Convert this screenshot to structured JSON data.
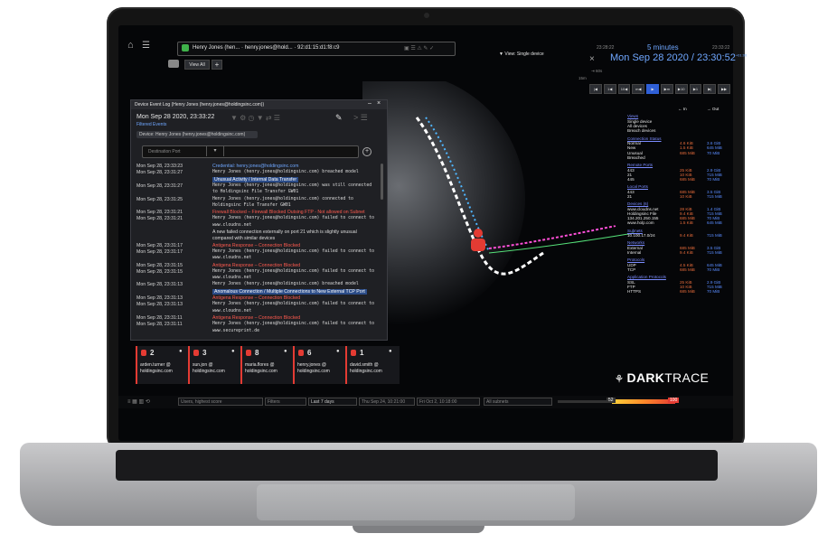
{
  "topbar": {
    "device_label": "Henry Jones (hen... · henry.jones@hold... · 92:d1:15:d1:f8:c9",
    "view_all": "View All",
    "view_mode": "View: Single device"
  },
  "timeline": {
    "time_left": "23:28:22",
    "window": "5 minutes",
    "time_right": "23:33:22",
    "clock": "Mon Sep 28 2020 / 23:30:52",
    "clock_sup": "+01:00",
    "scale_60": "60s",
    "scale_15m": "15m",
    "buttons": [
      "|◀",
      "1◀",
      "10◀",
      "m◀",
      "▶",
      "▶m",
      "▶10",
      "▶1",
      "▶|",
      "▶▶"
    ]
  },
  "event_log": {
    "title": "Device Event Log (Henry Jones (henry.jones@holdingsinc.com))",
    "date": "Mon Sep 28 2020, 23:33:22",
    "filtered": "Filtered Events",
    "device_chip": "Device: Henry Jones (henry.jones@holdingsinc.com)",
    "filter_placeholder": "Destination Port",
    "rows": [
      {
        "date": "Mon Sep 28, 23:33:23",
        "msg": "Credential: henry.jones@holdingsinc.com",
        "style": "blue"
      },
      {
        "date": "Mon Sep 28, 23:31:27",
        "msg": "Henry Jones (henry.jones@holdingsinc.com) breached model",
        "style": "mono"
      },
      {
        "date": "",
        "msg": "Unusual Activity / Internal Data Transfer",
        "style": "hl"
      },
      {
        "date": "Mon Sep 28, 23:31:27",
        "msg": "Henry Jones (henry.jones@holdingsinc.com) was still connected",
        "style": "mono"
      },
      {
        "date": "",
        "msg": "to Holdingsinc File Transfer GW01",
        "style": "mono"
      },
      {
        "date": "Mon Sep 28, 23:31:25",
        "msg": "Henry Jones (henry.jones@holdingsinc.com) connected to",
        "style": "mono"
      },
      {
        "date": "",
        "msg": "Holdingsinc File Transfer GW01",
        "style": "mono"
      },
      {
        "date": "Mon Sep 28, 23:31:21",
        "msg": "Firewall Blocked – Firewall Blocked Outsing FTP - Not allowed on Subnet",
        "style": "red"
      },
      {
        "date": "Mon Sep 28, 23:31:21",
        "msg": "Henry Jones (henry.jones@holdingsinc.com) failed to connect to",
        "style": "mono"
      },
      {
        "date": "",
        "msg": "www.cloudns.net",
        "style": "mono"
      },
      {
        "date": "",
        "msg": "A new failed connection externally on port 21 which is slightly unusual",
        "style": "plain"
      },
      {
        "date": "",
        "msg": "compared with similar devices",
        "style": "plain"
      },
      {
        "date": "Mon Sep 28, 23:31:17",
        "msg": "Antigena Response – Connection Blocked",
        "style": "red"
      },
      {
        "date": "Mon Sep 28, 23:31:17",
        "msg": "Henry Jones (henry.jones@holdingsinc.com) failed to connect to",
        "style": "mono"
      },
      {
        "date": "",
        "msg": "www.cloudns.net",
        "style": "mono"
      },
      {
        "date": "Mon Sep 28, 23:31:15",
        "msg": "Antigena Response – Connection Blocked",
        "style": "red"
      },
      {
        "date": "Mon Sep 28, 23:31:15",
        "msg": "Henry Jones (henry.jones@holdingsinc.com) failed to connect to",
        "style": "mono"
      },
      {
        "date": "",
        "msg": "www.cloudns.net",
        "style": "mono"
      },
      {
        "date": "Mon Sep 28, 23:31:13",
        "msg": "Henry Jones (henry.jones@holdingsinc.com) breached model",
        "style": "mono"
      },
      {
        "date": "",
        "msg": "Anomalous Connection / Multiple Connections to New External TCP Port",
        "style": "hl"
      },
      {
        "date": "Mon Sep 28, 23:31:13",
        "msg": "Antigena Response – Connection Blocked",
        "style": "red"
      },
      {
        "date": "Mon Sep 28, 23:31:13",
        "msg": "Henry Jones (henry.jones@holdingsinc.com) failed to connect to",
        "style": "mono"
      },
      {
        "date": "",
        "msg": "www.cloudns.net",
        "style": "mono"
      },
      {
        "date": "Mon Sep 28, 23:31:11",
        "msg": "Antigena Response – Connection Blocked",
        "style": "red"
      },
      {
        "date": "Mon Sep 28, 23:31:11",
        "msg": "Henry Jones (henry.jones@holdingsinc.com) failed to connect to",
        "style": "mono"
      },
      {
        "date": "",
        "msg": "www.secureprint.de",
        "style": "mono"
      }
    ]
  },
  "stats": {
    "header_in": "← In",
    "header_out": "→ Out",
    "views_title": "Views",
    "views": [
      "Single device",
      "All devices",
      "Breach devices"
    ],
    "sections": [
      {
        "title": "Connection Status",
        "rows": [
          [
            "Normal",
            "4.6 KiB",
            "3.6 GiB"
          ],
          [
            "New",
            "1.5 KiB",
            "645 MiB"
          ],
          [
            "Unusual",
            "685 MiB",
            "70 MiB"
          ],
          [
            "Breached",
            "",
            ""
          ]
        ]
      },
      {
        "title": "Remote Ports",
        "rows": [
          [
            "443",
            "25 KiB",
            "2.9 GiB"
          ],
          [
            "21",
            "10 KiB",
            "715 MiB"
          ],
          [
            "445",
            "685 MiB",
            "70 MiB"
          ]
        ]
      },
      {
        "title": "Local Ports",
        "rows": [
          [
            "443",
            "685 MiB",
            "3.5 GiB"
          ],
          [
            "21",
            "10 KiB",
            "715 MiB"
          ]
        ]
      },
      {
        "title": "Devices (6)",
        "rows": [
          [
            "www.cloudns.net",
            "28 KiB",
            "1.4 GiB"
          ],
          [
            "Holdingsinc File",
            "9.4 KiB",
            "715 MiB"
          ],
          [
            "134.201.250.155",
            "685 MiB",
            "70 MiB"
          ],
          [
            "www.holp.com",
            "1.5 KiB",
            "645 MiB"
          ]
        ]
      },
      {
        "title": "Subnets",
        "rows": [
          [
            "10.100.17.0/24",
            "9.4 KiB",
            "715 MiB"
          ]
        ]
      },
      {
        "title": "Networks",
        "rows": [
          [
            "External",
            "685 MiB",
            "3.5 GiB"
          ],
          [
            "Internal",
            "9.4 KiB",
            "715 MiB"
          ]
        ]
      },
      {
        "title": "Protocols",
        "rows": [
          [
            "UDP",
            "4.5 KiB",
            "645 MiB"
          ],
          [
            "TCP",
            "685 MiB",
            "70 MiB"
          ]
        ]
      },
      {
        "title": "Application Protocols",
        "rows": [
          [
            "SSL",
            "25 KiB",
            "2.9 GiB"
          ],
          [
            "FTP",
            "10 KiB",
            "715 MiB"
          ],
          [
            "HTTPS",
            "685 MiB",
            "70 MiB"
          ]
        ]
      }
    ]
  },
  "users": [
    {
      "count": "2",
      "name": "arden.turner @",
      "domain": "holdingsinc.com"
    },
    {
      "count": "3",
      "name": "sun.jon @",
      "domain": "holdingsinc.com"
    },
    {
      "count": "8",
      "name": "maria.flores @",
      "domain": "holdingsinc.com"
    },
    {
      "count": "6",
      "name": "henry.jones @",
      "domain": "holdingsinc.com"
    },
    {
      "count": "1",
      "name": "david.smith @",
      "domain": "holdingsinc.com"
    }
  ],
  "brand": {
    "dark": "DARK",
    "trace": "TRACE"
  },
  "bottombar": {
    "sort": "Users, highest score",
    "filters": "Filters",
    "period": "Last 7 days",
    "from": "Thu Sep 24, 10:21:00",
    "to": "Fri Oct 2, 10:18:00",
    "subnets": "All subnets",
    "score_min": "52",
    "score_max": "100"
  },
  "colors": {
    "accent_red": "#e43b33",
    "accent_blue": "#6fa7ff",
    "brand": "#ffffff"
  }
}
